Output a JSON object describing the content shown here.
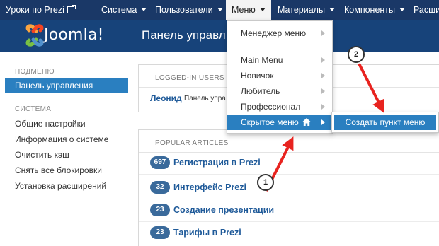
{
  "topbar": {
    "site_title": "Уроки по Prezi",
    "menu": [
      "Система",
      "Пользователи",
      "Меню",
      "Материалы",
      "Компоненты",
      "Расши"
    ],
    "active_menu": "Меню"
  },
  "header": {
    "logo_text": "Joomla!",
    "page_title": "Панель управл"
  },
  "sidebar": {
    "submenu_heading": "ПОДМЕНЮ",
    "active_item": "Панель управления",
    "system_heading": "СИСТЕМА",
    "items": [
      "Общие настройки",
      "Информация о системе",
      "Очистить кэш",
      "Снять все блокировки",
      "Установка расширений"
    ]
  },
  "logged_in": {
    "heading": "LOGGED-IN USERS",
    "user_name": "Леонид",
    "user_desc": "Панель упра"
  },
  "popular": {
    "heading": "POPULAR ARTICLES",
    "articles": [
      {
        "hits": "697",
        "title": "Регистрация в Prezi"
      },
      {
        "hits": "32",
        "title": "Интерфейс Prezi"
      },
      {
        "hits": "23",
        "title": "Создание презентации"
      },
      {
        "hits": "23",
        "title": "Тарифы в Prezi"
      }
    ]
  },
  "dropdown": {
    "items": [
      "Менеджер меню",
      "Main Menu",
      "Новичок",
      "Любитель",
      "Профессионал",
      "Скрытое меню"
    ],
    "highlighted": "Скрытое меню"
  },
  "submenu": {
    "item": "Создать пункт меню"
  },
  "callouts": {
    "one": "1",
    "two": "2"
  },
  "colors": {
    "topbar": "#1a3867",
    "header": "#17437a",
    "accent": "#2a7fc0",
    "arrow": "#e8231f"
  }
}
